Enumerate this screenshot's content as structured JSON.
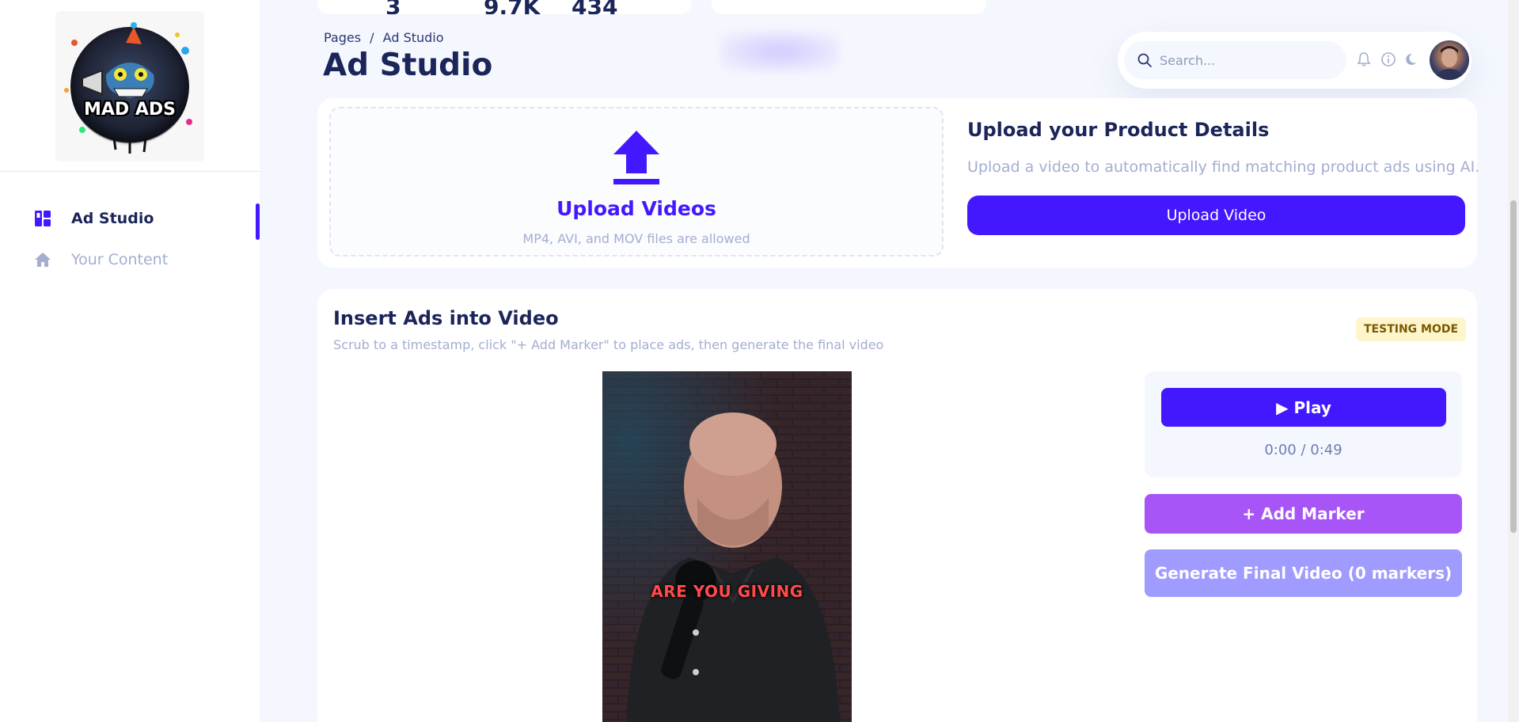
{
  "app": {
    "logo_text": "MAD ADS"
  },
  "sidebar": {
    "items": [
      {
        "label": "Ad Studio",
        "icon": "dashboard-icon",
        "active": true
      },
      {
        "label": "Your Content",
        "icon": "home-icon",
        "active": false
      }
    ]
  },
  "stats_peek": [
    "3",
    "9.7K",
    "434"
  ],
  "header": {
    "breadcrumb_parent": "Pages",
    "breadcrumb_separator": "/",
    "breadcrumb_current": "Ad Studio",
    "title": "Ad Studio",
    "search_placeholder": "Search..."
  },
  "upload": {
    "dropzone_title": "Upload Videos",
    "dropzone_subtitle": "MP4, AVI, and MOV files are allowed",
    "title": "Upload your Product Details",
    "description": "Upload a video to automatically find matching product ads using AI.",
    "button_label": "Upload Video"
  },
  "insert": {
    "title": "Insert Ads into Video",
    "subtitle": "Scrub to a timestamp, click \"+ Add Marker\" to place ads, then generate the final video",
    "badge": "TESTING MODE",
    "video_caption": "ARE YOU GIVING",
    "play_label": "Play",
    "time": "0:00 / 0:49",
    "add_marker_label": "+ Add Marker",
    "generate_label": "Generate Final Video (0 markers)"
  },
  "colors": {
    "accent": "#4318ff",
    "marker": "#a855f7",
    "generate_disabled": "#a09bff",
    "text_dark": "#1b2559",
    "text_muted": "#a3aed0"
  }
}
